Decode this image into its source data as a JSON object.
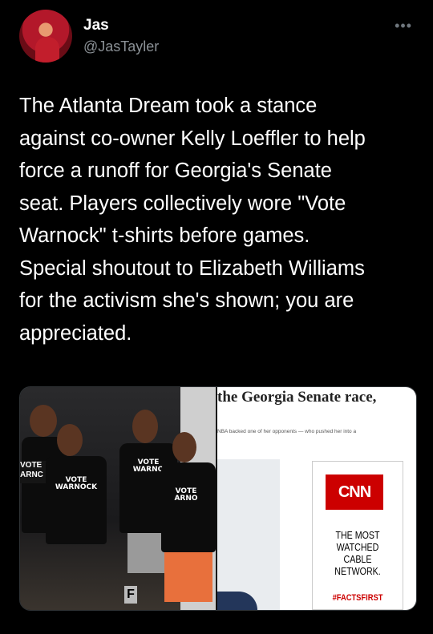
{
  "author": {
    "display_name": "Jas",
    "handle": "@JasTayler",
    "avatar_icon": "profile-photo",
    "more_icon": "more-horizontal-icon"
  },
  "tweet": {
    "text": "The Atlanta Dream took a stance\nagainst co-owner Kelly Loeffler to help\nforce a runoff for Georgia's Senate\nseat. Players collectively wore \"Vote\nWarnock\" t-shirts before games.\nSpecial shoutout to Elizabeth Williams\nfor the activism she's shown; you are\nappreciated."
  },
  "media": {
    "left_photo": {
      "shirt_texts": [
        "VOTE\nWARNOCK",
        "VOTE\nWARNO",
        "VOTE\nARNO"
      ],
      "sign_fragment": "VOTE\nARNC",
      "door_letter": "F"
    },
    "right_screenshot": {
      "headline": "the Georgia Senate race,",
      "subtext": "NBA backed one of her opponents — who pushed her into a",
      "ad_logo": "CNN",
      "ad_text": "THE MOST\nWATCHED\nCABLE NETWORK.",
      "ad_hashtag": "#FACTSFIRST"
    }
  },
  "colors": {
    "background": "#000000",
    "text": "#ffffff",
    "secondary_text": "#8b9196",
    "cnn_red": "#cc0000"
  }
}
